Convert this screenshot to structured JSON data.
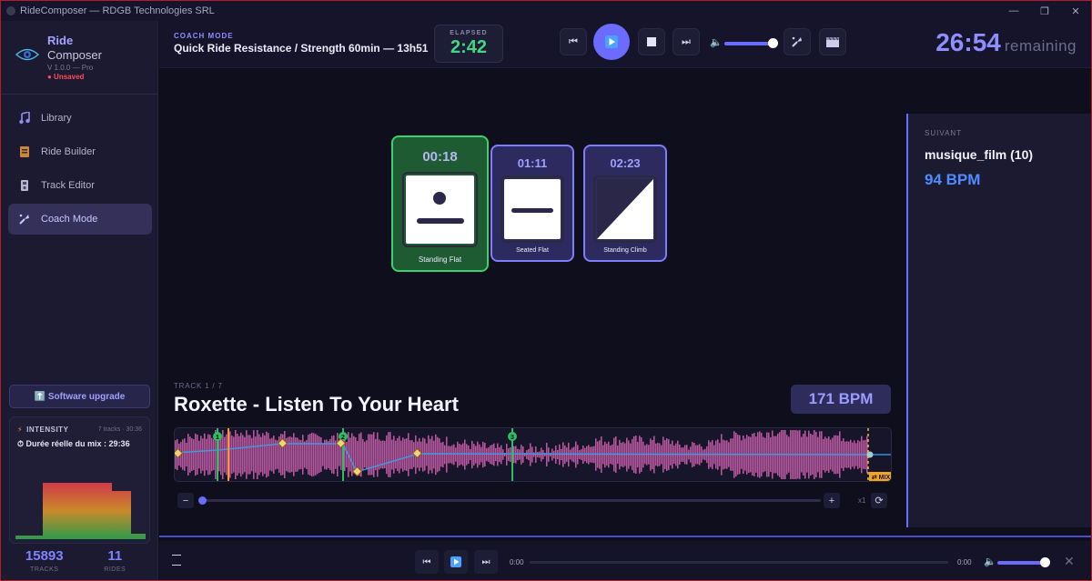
{
  "window": {
    "title": "RideComposer — RDGB Technologies SRL"
  },
  "sidebar": {
    "logo": {
      "line1": "Ride",
      "line2": "Composer",
      "version": "V 1.0.0 — Pro",
      "status": "● Unsaved"
    },
    "items": [
      {
        "label": "Library",
        "icon": "music-note-icon",
        "active": false
      },
      {
        "label": "Ride Builder",
        "icon": "ride-builder-icon",
        "active": false
      },
      {
        "label": "Track Editor",
        "icon": "track-editor-icon",
        "active": false
      },
      {
        "label": "Coach Mode",
        "icon": "coach-icon",
        "active": true
      }
    ],
    "upgrade_label": "⬆️ Software upgrade",
    "intensity": {
      "title": "INTENSITY",
      "meta": "7 tracks · 30:36",
      "duration": "⏱ Durée réelle du mix : 29:36"
    },
    "stats": [
      {
        "value": "15893",
        "label": "TRACKS"
      },
      {
        "value": "11",
        "label": "RIDES"
      }
    ]
  },
  "header": {
    "mode_label": "COACH MODE",
    "ride_title": "Quick Ride Resistance / Strength 60min — 13h51",
    "elapsed_label": "ELAPSED",
    "elapsed_value": "2:42",
    "remaining_value": "26:54",
    "remaining_label": "remaining",
    "volume": 0.85
  },
  "cards": [
    {
      "time": "00:18",
      "label": "Standing Flat",
      "state": "current",
      "color": "#2fbe63"
    },
    {
      "time": "01:11",
      "label": "Seated Flat",
      "state": "upcoming",
      "color": "#7d7dff"
    },
    {
      "time": "02:23",
      "label": "Standing Climb",
      "state": "upcoming",
      "color": "#7d7dff"
    }
  ],
  "track": {
    "index_label": "TRACK 1 / 7",
    "title": "Roxette - Listen To Your Heart",
    "bpm": "171 BPM",
    "markers": [
      "1",
      "2",
      "3"
    ],
    "mix_label": "⇄ MIX",
    "zoom_label": "x1"
  },
  "next": {
    "label": "SUIVANT",
    "title": "musique_film (10)",
    "bpm": "94 BPM"
  },
  "player": {
    "time_start": "0:00",
    "time_end": "0:00",
    "volume": 0.85
  }
}
